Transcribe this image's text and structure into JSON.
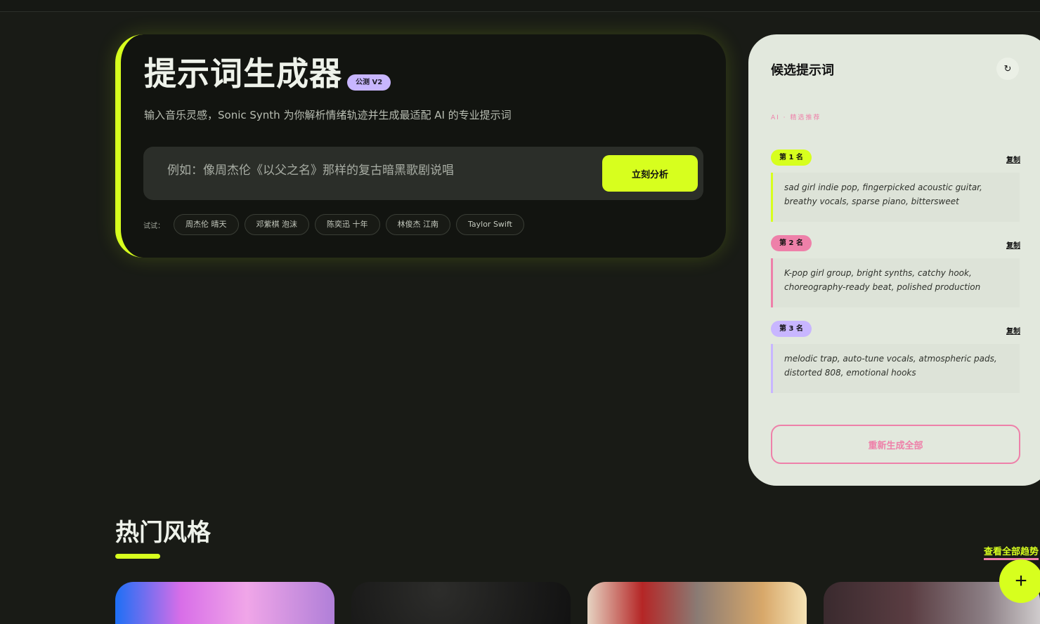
{
  "hero": {
    "title": "提示词生成器",
    "badge": "公测 V2",
    "subtitle": "输入音乐灵感，Sonic Synth 为你解析情绪轨迹并生成最适配 AI 的专业提示词",
    "input_placeholder": "例如：像周杰伦《以父之名》那样的复古暗黑歌剧说唱",
    "input_value": "",
    "analyze_label": "立刻分析",
    "try_label": "试试：",
    "chips": [
      "周杰伦 晴天",
      "邓紫棋 泡沫",
      "陈奕迅 十年",
      "林俊杰 江南",
      "Taylor Swift"
    ]
  },
  "panel": {
    "title": "候选提示词",
    "refresh_icon": "refresh-icon",
    "subtitle": "AI · 精选推荐",
    "candidates": [
      {
        "rank": "第 1 名",
        "copy": "复制",
        "text": "sad girl indie pop, fingerpicked acoustic guitar, breathy vocals, sparse piano, bittersweet",
        "color": "#d7ff1e"
      },
      {
        "rank": "第 2 名",
        "copy": "复制",
        "text": "K-pop girl group, bright synths, catchy hook, choreography-ready beat, polished production",
        "color": "#ee80a9"
      },
      {
        "rank": "第 3 名",
        "copy": "复制",
        "text": "melodic trap, auto-tune vocals, atmospheric pads, distorted 808, emotional hooks",
        "color": "#c8b6ff"
      }
    ],
    "regenerate_label": "重新生成全部"
  },
  "trending": {
    "title": "热门风格",
    "view_all": "查看全部趋势"
  },
  "fab": {
    "icon": "plus-icon",
    "symbol": "+"
  },
  "colors": {
    "accent": "#d7ff1e",
    "pink": "#ee80a9",
    "lavender": "#c8b6ff",
    "background": "#191b16"
  }
}
